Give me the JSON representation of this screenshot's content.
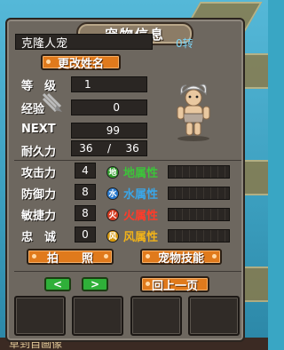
{
  "window": {
    "title": "宠物信息"
  },
  "pet": {
    "name": "克隆人宠",
    "rebirth": "0转",
    "rename_label": "更改姓名",
    "level_label": "等　级",
    "level": "1",
    "exp_label": "经验",
    "exp": "0",
    "next_label": "NEXT",
    "next": "99",
    "durability_label": "耐久力",
    "durability_cur": "36",
    "durability_sep": "/",
    "durability_max": "36",
    "attack_label": "攻击力",
    "attack": "4",
    "defense_label": "防御力",
    "defense": "8",
    "agility_label": "敏捷力",
    "agility": "8",
    "loyalty_label": "忠　诚",
    "loyalty": "0"
  },
  "elements": [
    {
      "name": "地属性",
      "color": "#3cc43a",
      "icon": "earth-icon",
      "glyph": "地"
    },
    {
      "name": "水属性",
      "color": "#3aa6e8",
      "icon": "water-icon",
      "glyph": "水"
    },
    {
      "name": "火属性",
      "color": "#ff3b2a",
      "icon": "fire-icon",
      "glyph": "火"
    },
    {
      "name": "风属性",
      "color": "#f0b21a",
      "icon": "wind-icon",
      "glyph": "风"
    }
  ],
  "buttons": {
    "photo": "拍　　照",
    "skills": "宠物技能",
    "prev": "<",
    "next": ">",
    "back": "回上一页"
  },
  "background": {
    "footer_text": "草到自画像"
  }
}
